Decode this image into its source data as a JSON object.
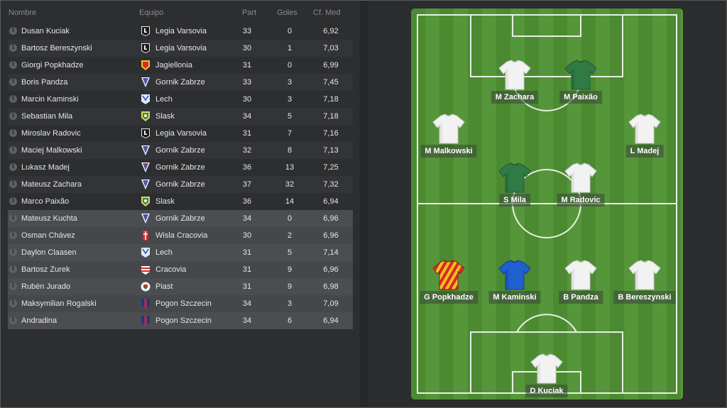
{
  "table": {
    "headers": {
      "name": "Nombre",
      "team": "Equipo",
      "apps": "Part",
      "goals": "Goles",
      "rating": "Cf. Med"
    },
    "rows": [
      {
        "name": "Dusan Kuciak",
        "team": "Legia Varsovia",
        "apps": "33",
        "goals": "0",
        "rating": "6,92",
        "crest": "legia"
      },
      {
        "name": "Bartosz Bereszynski",
        "team": "Legia Varsovia",
        "apps": "30",
        "goals": "1",
        "rating": "7,03",
        "crest": "legia"
      },
      {
        "name": "Giorgi Popkhadze",
        "team": "Jagiellonia",
        "apps": "31",
        "goals": "0",
        "rating": "6,99",
        "crest": "jagiellonia"
      },
      {
        "name": "Boris Pandza",
        "team": "Gornik Zabrze",
        "apps": "33",
        "goals": "3",
        "rating": "7,45",
        "crest": "gornik"
      },
      {
        "name": "Marcin Kaminski",
        "team": "Lech",
        "apps": "30",
        "goals": "3",
        "rating": "7,18",
        "crest": "lech"
      },
      {
        "name": "Sebastian Mila",
        "team": "Slask",
        "apps": "34",
        "goals": "5",
        "rating": "7,18",
        "crest": "slask"
      },
      {
        "name": "Miroslav Radovic",
        "team": "Legia Varsovia",
        "apps": "31",
        "goals": "7",
        "rating": "7,16",
        "crest": "legia"
      },
      {
        "name": "Maciej Malkowski",
        "team": "Gornik Zabrze",
        "apps": "32",
        "goals": "8",
        "rating": "7,13",
        "crest": "gornik"
      },
      {
        "name": "Lukasz Madej",
        "team": "Gornik Zabrze",
        "apps": "36",
        "goals": "13",
        "rating": "7,25",
        "crest": "gornik"
      },
      {
        "name": "Mateusz Zachara",
        "team": "Gornik Zabrze",
        "apps": "37",
        "goals": "32",
        "rating": "7,32",
        "crest": "gornik"
      },
      {
        "name": "Marco Paixão",
        "team": "Slask",
        "apps": "36",
        "goals": "14",
        "rating": "6,94",
        "crest": "slask"
      },
      {
        "name": "Mateusz Kuchta",
        "team": "Gornik Zabrze",
        "apps": "34",
        "goals": "0",
        "rating": "6,96",
        "crest": "gornik"
      },
      {
        "name": "Osman Chávez",
        "team": "Wisla Cracovia",
        "apps": "30",
        "goals": "2",
        "rating": "6,96",
        "crest": "wisla"
      },
      {
        "name": "Daylon Claasen",
        "team": "Lech",
        "apps": "31",
        "goals": "5",
        "rating": "7,14",
        "crest": "lech"
      },
      {
        "name": "Bartosz Zurek",
        "team": "Cracovia",
        "apps": "31",
        "goals": "9",
        "rating": "6,96",
        "crest": "cracovia"
      },
      {
        "name": "Rubén Jurado",
        "team": "Piast",
        "apps": "31",
        "goals": "9",
        "rating": "6,98",
        "crest": "piast"
      },
      {
        "name": "Maksymilian Rogalski",
        "team": "Pogon Szczecin",
        "apps": "34",
        "goals": "3",
        "rating": "7,09",
        "crest": "pogon"
      },
      {
        "name": "Andradina",
        "team": "Pogon Szczecin",
        "apps": "34",
        "goals": "6",
        "rating": "6,94",
        "crest": "pogon"
      }
    ]
  },
  "pitch": {
    "players": [
      {
        "label": "M Zachara",
        "kit": "white"
      },
      {
        "label": "M Paixão",
        "kit": "green"
      },
      {
        "label": "M Malkowski",
        "kit": "white"
      },
      {
        "label": "L Madej",
        "kit": "white"
      },
      {
        "label": "S Mila",
        "kit": "green"
      },
      {
        "label": "M Radovic",
        "kit": "white"
      },
      {
        "label": "G Popkhadze",
        "kit": "jagiellonia"
      },
      {
        "label": "M Kaminski",
        "kit": "blue"
      },
      {
        "label": "B Pandza",
        "kit": "white"
      },
      {
        "label": "B Bereszynski",
        "kit": "white"
      },
      {
        "label": "D Kuciak",
        "kit": "white"
      }
    ]
  },
  "colors": {
    "kit_white": "#f2f2f2",
    "kit_green": "#2f7a45",
    "kit_blue": "#1f5fd0",
    "kit_jagiellonia_red": "#d8282a",
    "kit_jagiellonia_yellow": "#f2c21a"
  }
}
